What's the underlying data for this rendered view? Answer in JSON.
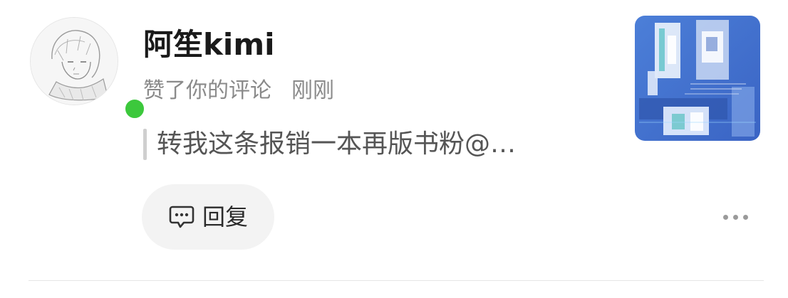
{
  "notification": {
    "username": "阿笙kimi",
    "action": "赞了你的评论",
    "time": "刚刚",
    "quoted_comment": "转我这条报销一本再版书粉@…",
    "reply_label": "回复",
    "online_status_color": "#3cc83c",
    "avatar_icon": "avatar",
    "thumbnail_icon": "post-thumbnail",
    "more_icon": "more-icon"
  }
}
